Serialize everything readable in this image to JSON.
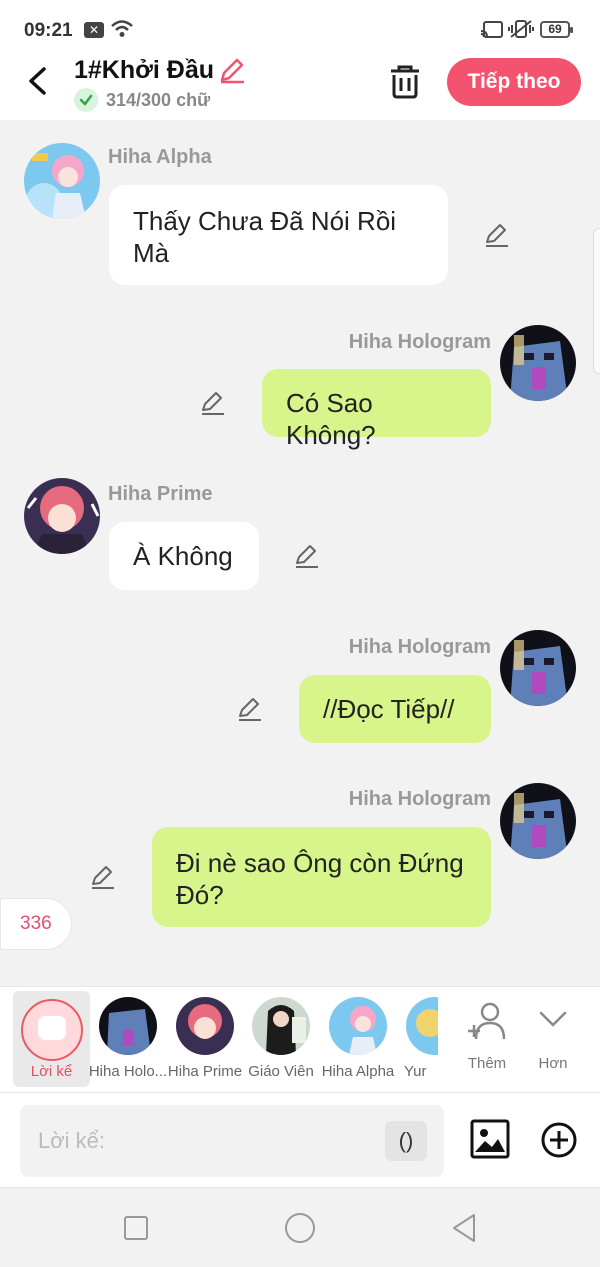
{
  "status": {
    "time": "09:21",
    "battery": "69",
    "x_icon": "✕"
  },
  "header": {
    "title": "1#Khởi Đầu",
    "word_count": "314/300 chữ",
    "next_label": "Tiếp theo"
  },
  "messages": [
    {
      "sender": "Hiha Alpha",
      "text": "Thấy Chưa Đã Nói Rồi Mà",
      "side": "left"
    },
    {
      "sender": "Hiha Hologram",
      "text": "Có Sao Không?",
      "side": "right"
    },
    {
      "sender": "Hiha Prime",
      "text": "À Không",
      "side": "left"
    },
    {
      "sender": "Hiha Hologram",
      "text": "//Đọc Tiếp//",
      "side": "right"
    },
    {
      "sender": "Hiha Hologram",
      "text": "Đi nè sao Ông còn Đứng Đó?",
      "side": "right"
    }
  ],
  "badge_count": "336",
  "characters": [
    {
      "label": "Lời kể",
      "selected": true
    },
    {
      "label": "Hiha Holo..."
    },
    {
      "label": "Hiha Prime"
    },
    {
      "label": "Giáo Viên"
    },
    {
      "label": "Hiha Alpha"
    },
    {
      "label": "Yur"
    }
  ],
  "tools": {
    "add_label": "Thêm",
    "more_label": "Hơn"
  },
  "input": {
    "placeholder": "Lời kể:",
    "paren_label": "()"
  },
  "colors": {
    "accent": "#f4536f",
    "right_bubble": "#d7f58b",
    "left_bubble": "#ffffff"
  }
}
